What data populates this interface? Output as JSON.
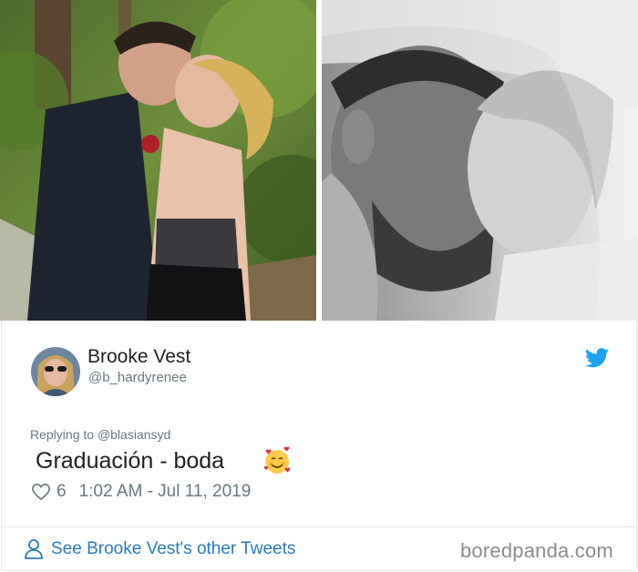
{
  "photos": {
    "left": {
      "alt": ""
    },
    "right": {
      "alt": ""
    }
  },
  "tweet": {
    "display_name": "Brooke Vest",
    "handle": "@b_hardyrenee",
    "replying_prefix": "Replying to",
    "replying_to": "@blasiansyd",
    "text": "Graduación - boda",
    "emoji": "smiling-face-with-hearts",
    "like_count": "6",
    "timestamp": "1:02 AM - Jul 11, 2019",
    "see_more": "See Brooke Vest's other Tweets"
  },
  "brand": {
    "watermark": "boredpanda.com"
  },
  "colors": {
    "twitter_blue": "#1da1f2",
    "link_blue": "#2b7bb9",
    "secondary_text": "#697882"
  },
  "icons": {
    "bird": "twitter-bird-icon",
    "heart": "heart-outline-icon",
    "user": "user-outline-icon"
  }
}
